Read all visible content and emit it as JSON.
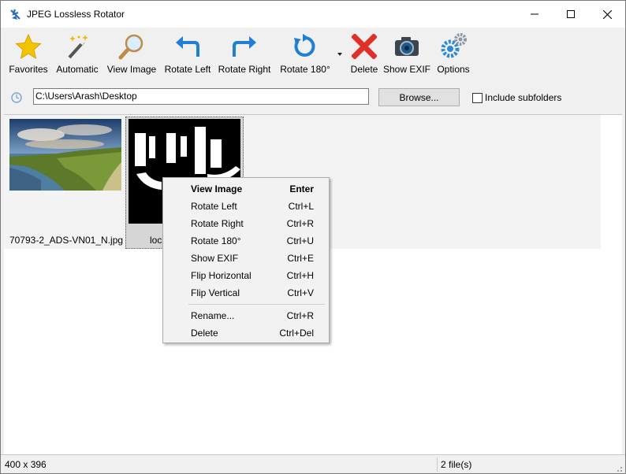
{
  "window": {
    "title": "JPEG Lossless Rotator"
  },
  "toolbar": {
    "favorites": "Favorites",
    "automatic": "Automatic",
    "view_image": "View Image",
    "rotate_left": "Rotate Left",
    "rotate_right": "Rotate Right",
    "rotate_180": "Rotate 180°",
    "delete": "Delete",
    "show_exif": "Show EXIF",
    "options": "Options"
  },
  "address": {
    "path": "C:\\Users\\Arash\\Desktop",
    "browse": "Browse...",
    "include_subfolders": "Include subfolders"
  },
  "files": [
    {
      "name": "70793-2_ADS-VN01_N.jpg"
    },
    {
      "name": "loc"
    }
  ],
  "context_menu": {
    "items": [
      {
        "label": "View Image",
        "shortcut": "Enter"
      },
      {
        "label": "Rotate Left",
        "shortcut": "Ctrl+L"
      },
      {
        "label": "Rotate Right",
        "shortcut": "Ctrl+R"
      },
      {
        "label": "Rotate 180°",
        "shortcut": "Ctrl+U"
      },
      {
        "label": "Show EXIF",
        "shortcut": "Ctrl+E"
      },
      {
        "label": "Flip Horizontal",
        "shortcut": "Ctrl+H"
      },
      {
        "label": "Flip Vertical",
        "shortcut": "Ctrl+V"
      },
      {
        "label": "Rename...",
        "shortcut": "Ctrl+R"
      },
      {
        "label": "Delete",
        "shortcut": "Ctrl+Del"
      }
    ]
  },
  "status": {
    "dimensions": "400 x 396",
    "file_count": "2 file(s)"
  }
}
